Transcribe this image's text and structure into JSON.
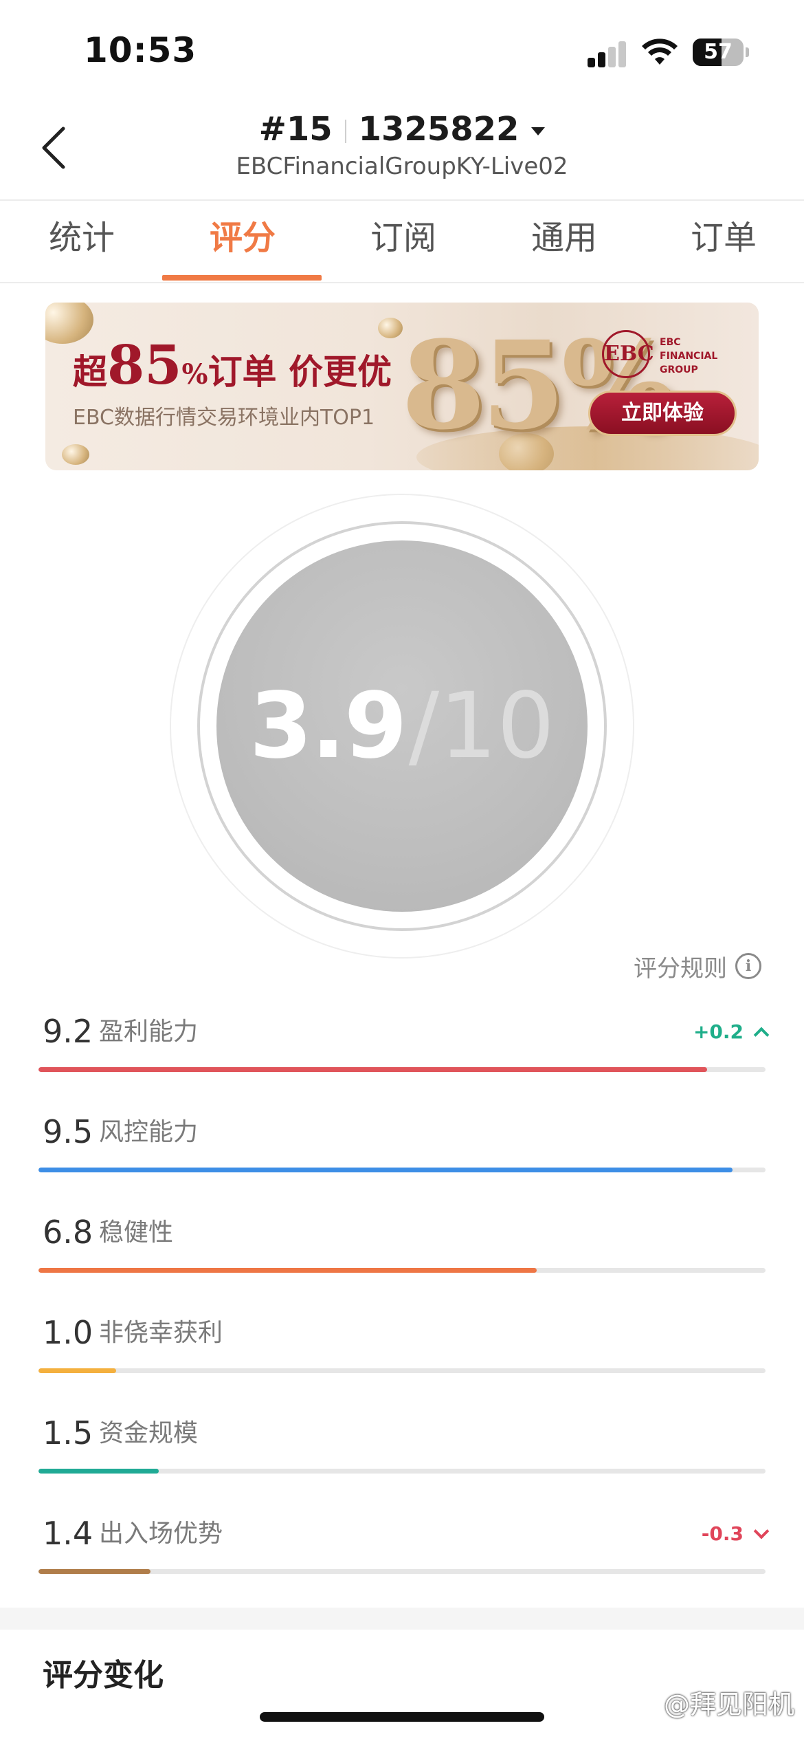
{
  "status_bar": {
    "time": "10:53",
    "battery": "57",
    "battery_level": 0.57
  },
  "header": {
    "rank": "#15",
    "account": "1325822",
    "server": "EBCFinancialGroupKY-Live02"
  },
  "tabs": [
    {
      "label": "统计",
      "active": false
    },
    {
      "label": "评分",
      "active": true
    },
    {
      "label": "订阅",
      "active": false
    },
    {
      "label": "通用",
      "active": false
    },
    {
      "label": "订单",
      "active": false
    }
  ],
  "banner": {
    "headline_prefix": "超",
    "headline_number": "85",
    "headline_percent": "%",
    "headline_suffix": "订单 价更优",
    "subtitle": "EBC数据行情交易环境业内TOP1",
    "big_number": "85%",
    "logo_mark": "EBC",
    "logo_text": "EBC\nFINANCIAL\nGROUP",
    "cta": "立即体验",
    "brand_color": "#a0182a"
  },
  "score": {
    "value": "3.9",
    "slash": "/",
    "max": "10"
  },
  "rules_link": {
    "label": "评分规则",
    "icon": "info-icon"
  },
  "metrics": [
    {
      "value": "9.2",
      "label": "盈利能力",
      "change": "+0.2",
      "direction": "up",
      "change_color": "#1fae8a",
      "fill": 0.92,
      "color": "#e0545a"
    },
    {
      "value": "9.5",
      "label": "风控能力",
      "change": "",
      "direction": "",
      "change_color": "",
      "fill": 0.955,
      "color": "#3d8ee6"
    },
    {
      "value": "6.8",
      "label": "稳健性",
      "change": "",
      "direction": "",
      "change_color": "",
      "fill": 0.685,
      "color": "#ee7645"
    },
    {
      "value": "1.0",
      "label": "非侥幸获利",
      "change": "",
      "direction": "",
      "change_color": "",
      "fill": 0.107,
      "color": "#f4b03e"
    },
    {
      "value": "1.5",
      "label": "资金规模",
      "change": "",
      "direction": "",
      "change_color": "",
      "fill": 0.165,
      "color": "#20aa95"
    },
    {
      "value": "1.4",
      "label": "出入场优势",
      "change": "-0.3",
      "direction": "down",
      "change_color": "#e0455a",
      "fill": 0.154,
      "color": "#b07d4a"
    }
  ],
  "section": {
    "title": "评分变化"
  },
  "watermark": "@拜见阳机"
}
